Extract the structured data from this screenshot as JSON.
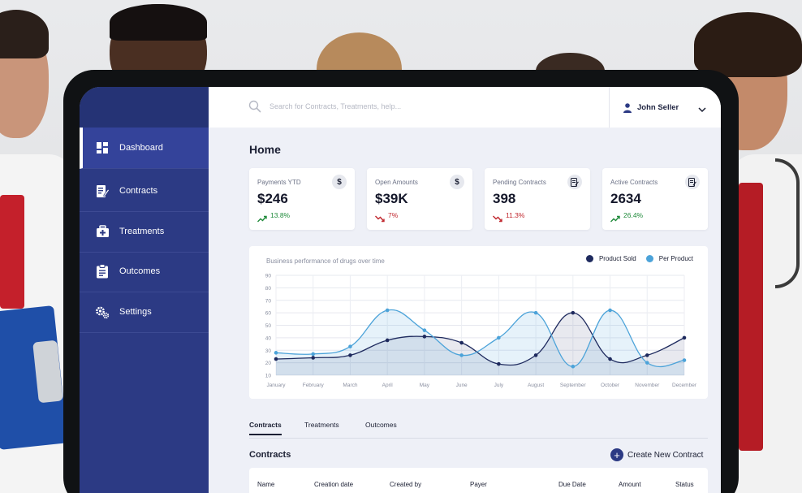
{
  "search": {
    "placeholder": "Search for Contracts, Treatments, help..."
  },
  "user": {
    "name": "John Seller",
    "icon": "user-icon"
  },
  "sidebar": {
    "items": [
      {
        "label": "Dashboard",
        "icon": "dashboard-icon",
        "active": true
      },
      {
        "label": "Contracts",
        "icon": "contract-edit-icon",
        "active": false
      },
      {
        "label": "Treatments",
        "icon": "medical-kit-icon",
        "active": false
      },
      {
        "label": "Outcomes",
        "icon": "clipboard-icon",
        "active": false
      },
      {
        "label": "Settings",
        "icon": "gears-icon",
        "active": false
      }
    ]
  },
  "page": {
    "title": "Home"
  },
  "cards": [
    {
      "label": "Payments YTD",
      "value": "$246",
      "change": "13.8%",
      "trend": "up",
      "icon": "$"
    },
    {
      "label": "Open Amounts",
      "value": "$39K",
      "change": "7%",
      "trend": "down",
      "icon": "$"
    },
    {
      "label": "Pending Contracts",
      "value": "398",
      "change": "11.3%",
      "trend": "down",
      "icon": "doc"
    },
    {
      "label": "Active Contracts",
      "value": "2634",
      "change": "26.4%",
      "trend": "up",
      "icon": "doc"
    }
  ],
  "colors": {
    "up": "#1f8a3a",
    "down": "#c0262d",
    "navy": "#2c3a84",
    "series1": "#1e2a5e",
    "series2": "#4ca3d9"
  },
  "chart_data": {
    "type": "line",
    "title": "Business performance of drugs over time",
    "categories": [
      "January",
      "February",
      "March",
      "April",
      "May",
      "June",
      "July",
      "August",
      "September",
      "October",
      "November",
      "December"
    ],
    "ylim": [
      10,
      90
    ],
    "yticks": [
      10,
      20,
      30,
      40,
      50,
      60,
      70,
      80,
      90
    ],
    "grid": true,
    "legend": "top-right",
    "series": [
      {
        "name": "Product Sold",
        "color": "#1e2a5e",
        "values": [
          23,
          24,
          26,
          38,
          41,
          36,
          19,
          26,
          60,
          23,
          26,
          40
        ]
      },
      {
        "name": "Per Product",
        "color": "#4ca3d9",
        "values": [
          28,
          27,
          33,
          62,
          46,
          26,
          40,
          60,
          17,
          62,
          20,
          22
        ]
      }
    ]
  },
  "tabs": [
    {
      "label": "Contracts",
      "active": true
    },
    {
      "label": "Treatments",
      "active": false
    },
    {
      "label": "Outcomes",
      "active": false
    }
  ],
  "section": {
    "title": "Contracts",
    "create_label": "Create New Contract"
  },
  "table": {
    "columns": [
      "Name",
      "Creation date",
      "Created by",
      "Payer",
      "Due Date",
      "Amount",
      "Status"
    ]
  }
}
